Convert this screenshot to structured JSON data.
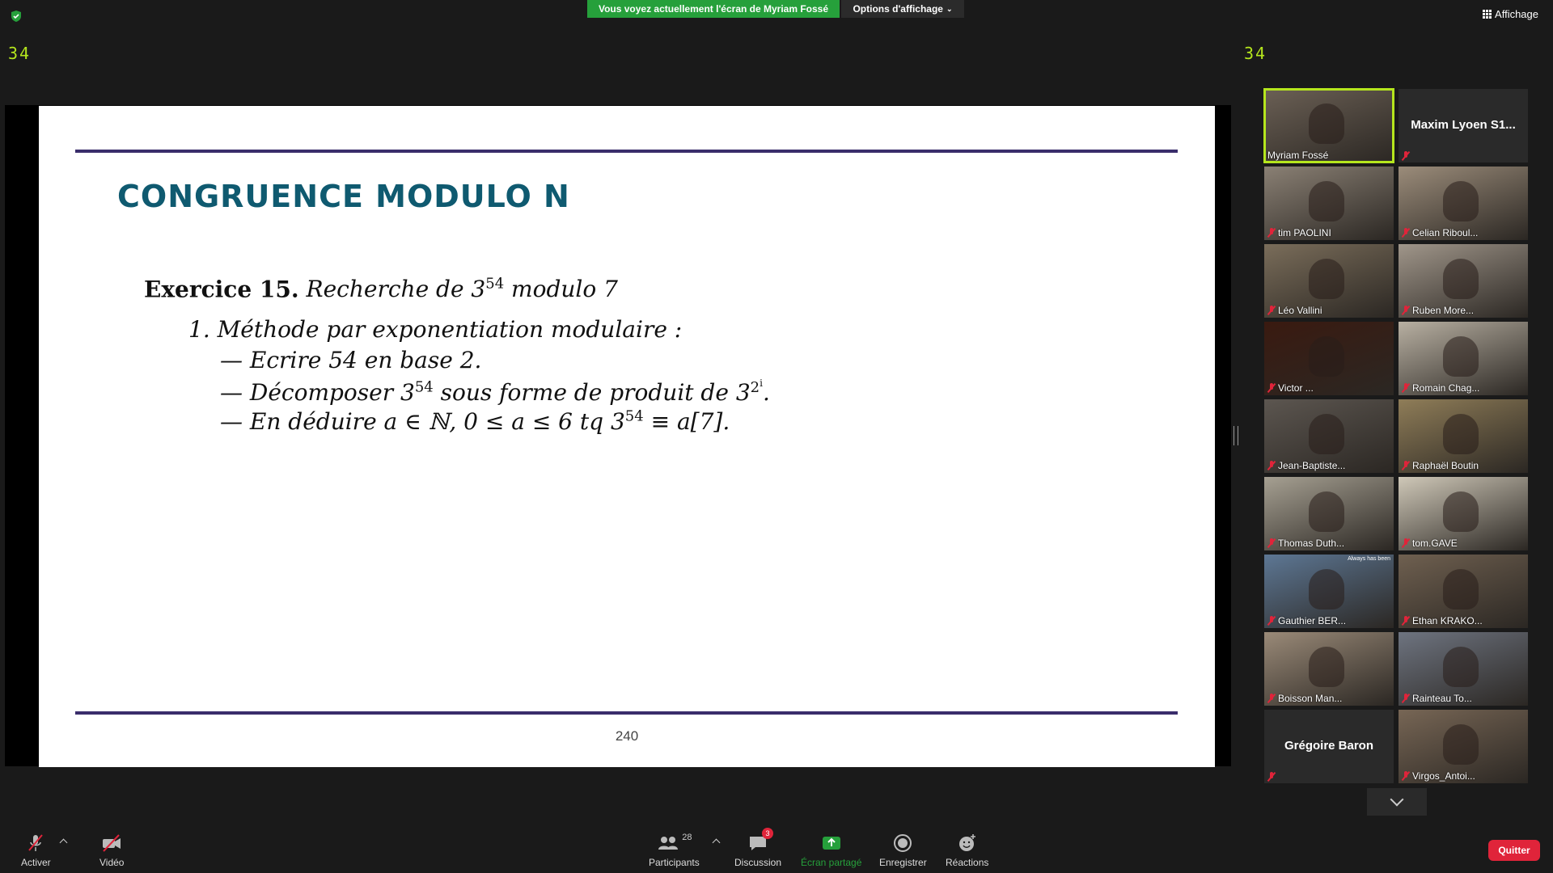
{
  "top": {
    "share_banner": "Vous voyez actuellement l'écran de Myriam Fossé",
    "view_options": "Options d'affichage",
    "affichage": "Affichage",
    "counter_left": "34",
    "counter_right": "34"
  },
  "slide": {
    "title": "CONGRUENCE MODULO N",
    "exercise_label": "Exercice 15.",
    "exercise_text": "Recherche de 3",
    "exercise_exp": "54",
    "exercise_tail": " modulo 7",
    "item1": "1.  Méthode par exponentiation modulaire :",
    "bullet1": "—  Ecrire 54 en base 2.",
    "bullet2_a": "—  Décomposer 3",
    "bullet2_exp": "54",
    "bullet2_b": " sous forme de produit de 3",
    "bullet2_exp2": "2",
    "bullet2_exp3": "i",
    "bullet2_c": ".",
    "bullet3_a": "—  En déduire a ∈ ℕ, 0 ≤ a ≤ 6 tq 3",
    "bullet3_exp": "54",
    "bullet3_b": " ≡ a[7].",
    "page_number": "240"
  },
  "gallery": {
    "participants": [
      "Myriam Fossé",
      "Maxim Lyoen S1...",
      "tim PAOLINI",
      "Celian Riboul...",
      "Léo Vallini",
      "Ruben More...",
      "Victor ...",
      "Romain Chag...",
      "Jean-Baptiste...",
      "Raphaël Boutin",
      "Thomas Duth...",
      "tom.GAVE",
      "Gauthier BER...",
      "Ethan KRAKO...",
      "Boisson Man...",
      "Rainteau To...",
      "Grégoire Baron",
      "Virgos_Antoi..."
    ],
    "overlay_text": "Always has been"
  },
  "toolbar": {
    "activer": "Activer",
    "video": "Vidéo",
    "participants": "Participants",
    "participants_count": "28",
    "discussion": "Discussion",
    "discussion_badge": "3",
    "ecran_partage": "Écran partagé",
    "enregistrer": "Enregistrer",
    "reactions": "Réactions",
    "quitter": "Quitter"
  },
  "colors": {
    "share_green": "#26a03b",
    "active_speaker": "#b5e61d",
    "quit_red": "#e0243a",
    "slide_title": "#0f5a70",
    "slide_rule": "#3a2d6b"
  }
}
